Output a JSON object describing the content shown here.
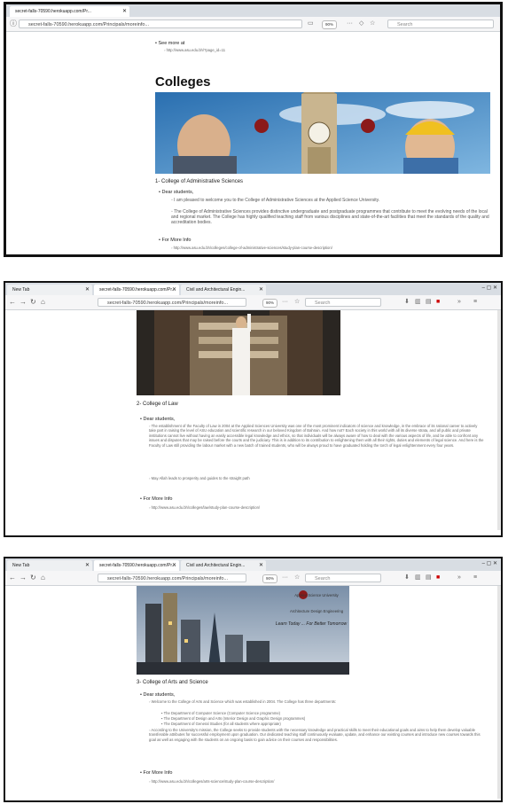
{
  "panel1": {
    "tab_title": "secret-falls-70590.herokuapp.com/Pr...",
    "tab_close": "✕",
    "url": "secret-falls-70590.herokuapp.com/Principals/moreinfo...",
    "zoom": "90%",
    "more": "···",
    "search_placeholder": "Search",
    "prev_bullet": "See more at",
    "prev_link": "http://www.asu.edu.bh/?page_id=11",
    "heading": "Colleges",
    "college_title": "1- College of Administrative Sciences",
    "dear": "Dear students,",
    "sub1": "I am pleased to welcome you to the College of Administrative Sciences at the Applied Science University.",
    "sub2": "The College of Administrative Sciences provides distinctive undergraduate and postgraduate programmes that contribute to meet the evolving needs of the local and regional market. The College has highly qualified teaching staff from various disciplines and state-of-the-art facilities that meet the standards of the quality and accreditation bodies.",
    "more_info": "For More Info",
    "more_link": "http://www.asu.edu.bh/colleges/college-of-administrative-sciences/study-plan-course-description/"
  },
  "panel2": {
    "tabs": [
      "New Tab",
      "secret-falls-70590.herokuapp.com/Pr...",
      "Civil and Architectural Engin..."
    ],
    "url": "secret-falls-70590.herokuapp.com/Principals/moreinfo...",
    "zoom": "90%",
    "search_placeholder": "Search",
    "college_title": "2- College of Law",
    "dear": "Dear students,",
    "para": "The establishment of the Faculty of Law in 2004 at the Applied Sciences University was one of the most prominent indicators of science and knowledge, in the embrace of its rational career to actively take part in raising the level of ASU education and scientific research in our beloved Kingdom of Bahrain. And how not? Each society in this world with all its diverse strata, and all public and private institutions cannot live without having an easily accessible legal knowledge and ethics, so that individuals will be always aware of how to deal with the various aspects of life, and be able to confront any issues and disputes that may be raised before the courts and the judiciary. This is in addition to its contribution to enlightening them with all their rights, duties and elements of legal science. And here is the Faculty of Law still providing the labour market with a new batch of trained students, who will be always proud to have graduated holding the torch of legal enlightenment every four years.",
    "para2": "May Allah leads to prosperity and guides to the straight path",
    "more_info": "For More Info",
    "more_link": "http://www.asu.edu.bh/colleges/law/study-plan-course-description/"
  },
  "panel3": {
    "tabs": [
      "New Tab",
      "secret-falls-70590.herokuapp.com/Pr...",
      "Civil and Architectural Engin..."
    ],
    "url": "secret-falls-70590.herokuapp.com/Principals/moreinfo...",
    "zoom": "90%",
    "search_placeholder": "Search",
    "banner_line1": "Applied Science University",
    "banner_line2": "Architecture Design Engineering",
    "banner_line3": "Learn Today ... For Better Tomorrow",
    "college_title": "3- College of Arts and Science",
    "dear": "Dear students,",
    "welcome": "Welcome to the College of Arts and Science which was established in 2004. The College has three departments:",
    "dept1": "The Department of Computer Science (Computer Science programme)",
    "dept2": "The Department of Design and Arts (Interior Design and Graphic Design programmes)",
    "dept3": "The Department of General Studies (for all students where appropriate)",
    "para": "According to the University's mission, the College seeks to provide students with the necessary knowledge and practical skills to meet their educational goals and aims to help them develop valuable transferable attributes for successful employment upon graduation. Our dedicated teaching staff continuously evaluate, update, and enhance our existing courses and introduce new courses towards this goal as well as engaging with the students on an ongoing basis to gain advice on their courses and responsibilities.",
    "more_info": "For More Info",
    "more_link": "http://www.asu.edu.bh/colleges/arts-science/study-plan-course-description/"
  }
}
